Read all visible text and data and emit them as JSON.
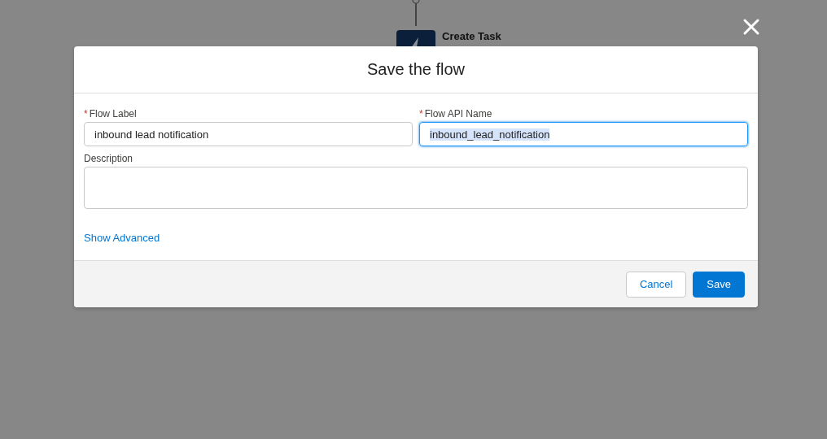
{
  "canvas": {
    "node": {
      "title": "Create Task"
    }
  },
  "modal": {
    "title": "Save the flow",
    "fields": [
      {
        "label": "Flow Label",
        "required_mark": "*",
        "value": "inbound lead notification",
        "focused": false,
        "selected_text": false
      },
      {
        "label": "Flow API Name",
        "required_mark": "*",
        "value": "inbound_lead_notification",
        "focused": true,
        "selected_text": true
      }
    ],
    "description": {
      "label": "Description"
    },
    "link": "Show Advanced",
    "buttons": [
      {
        "label": "Cancel",
        "kind": "neutral"
      },
      {
        "label": "Save",
        "kind": "brand"
      }
    ]
  }
}
